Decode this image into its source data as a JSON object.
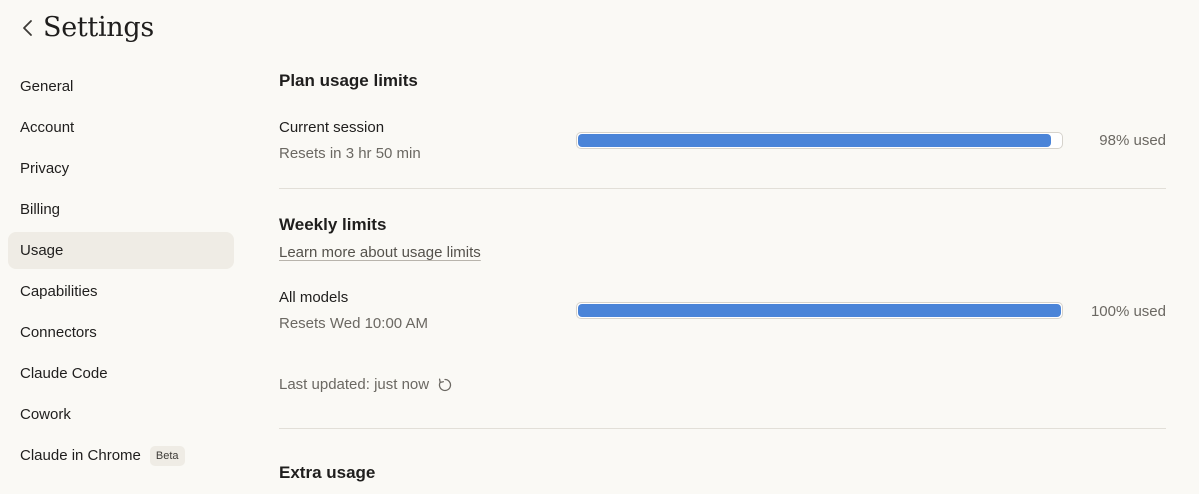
{
  "header": {
    "title": "Settings"
  },
  "sidebar": {
    "items": [
      {
        "label": "General"
      },
      {
        "label": "Account"
      },
      {
        "label": "Privacy"
      },
      {
        "label": "Billing"
      },
      {
        "label": "Usage",
        "active": true
      },
      {
        "label": "Capabilities"
      },
      {
        "label": "Connectors"
      },
      {
        "label": "Claude Code"
      },
      {
        "label": "Cowork"
      },
      {
        "label": "Claude in Chrome",
        "badge": "Beta"
      }
    ]
  },
  "plan_usage": {
    "title": "Plan usage limits",
    "current_session": {
      "label": "Current session",
      "sub": "Resets in 3 hr 50 min",
      "percent": 98,
      "percent_text": "98% used"
    }
  },
  "weekly": {
    "title": "Weekly limits",
    "learn_more": "Learn more about usage limits",
    "all_models": {
      "label": "All models",
      "sub": "Resets Wed 10:00 AM",
      "percent": 100,
      "percent_text": "100% used"
    },
    "last_updated": "Last updated: just now"
  },
  "extra_usage": {
    "title": "Extra usage"
  },
  "colors": {
    "accent_bar": "#4a84d8",
    "background": "#faf9f5",
    "active_nav": "#efece5"
  },
  "icons": {
    "back": "chevron-left-icon",
    "refresh": "refresh-icon"
  }
}
